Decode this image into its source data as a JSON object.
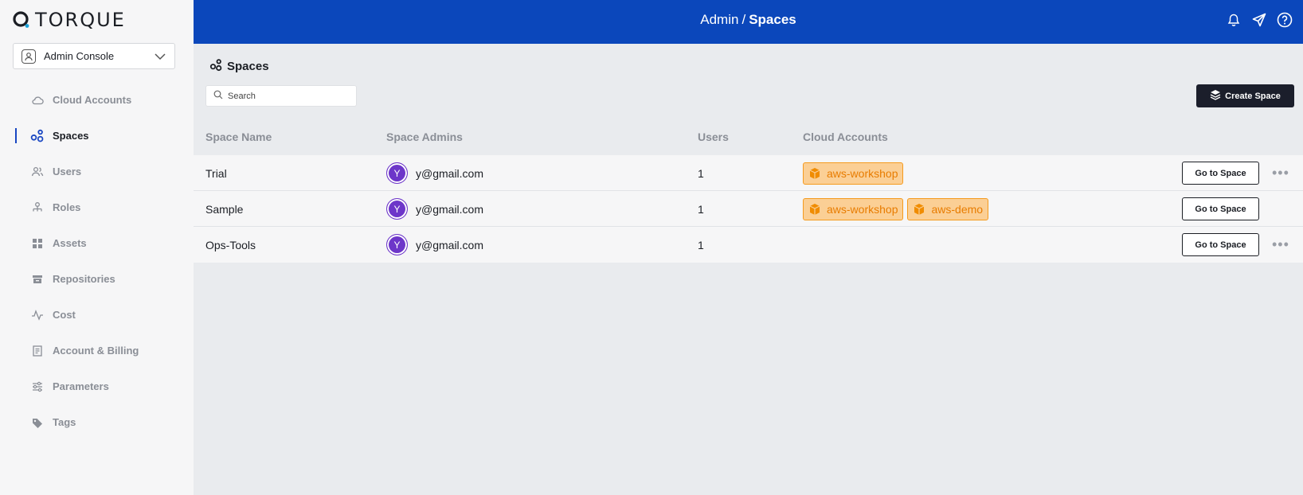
{
  "app": {
    "brand": "TORQUE"
  },
  "console": {
    "label": "Admin Console"
  },
  "nav": [
    {
      "label": "Cloud Accounts",
      "icon": "cloud-icon"
    },
    {
      "label": "Spaces",
      "icon": "spaces-icon",
      "active": true
    },
    {
      "label": "Users",
      "icon": "users-icon"
    },
    {
      "label": "Roles",
      "icon": "roles-icon"
    },
    {
      "label": "Assets",
      "icon": "assets-icon"
    },
    {
      "label": "Repositories",
      "icon": "repositories-icon"
    },
    {
      "label": "Cost",
      "icon": "cost-icon"
    },
    {
      "label": "Account & Billing",
      "icon": "billing-icon"
    },
    {
      "label": "Parameters",
      "icon": "parameters-icon"
    },
    {
      "label": "Tags",
      "icon": "tags-icon"
    }
  ],
  "header": {
    "crumb_root": "Admin",
    "crumb_sep": "/",
    "crumb_current": "Spaces"
  },
  "page": {
    "title": "Spaces",
    "search_placeholder": "Search",
    "create_label": "Create Space"
  },
  "table": {
    "columns": [
      "Space Name",
      "Space Admins",
      "Users",
      "Cloud Accounts"
    ],
    "go_label": "Go to Space",
    "rows": [
      {
        "name": "Trial",
        "admin_initial": "Y",
        "admin": "y@gmail.com",
        "users": "1",
        "clouds": [
          "aws-workshop"
        ],
        "more": true
      },
      {
        "name": "Sample",
        "admin_initial": "Y",
        "admin": "y@gmail.com",
        "users": "1",
        "clouds": [
          "aws-workshop",
          "aws-demo"
        ],
        "more": false
      },
      {
        "name": "Ops-Tools",
        "admin_initial": "Y",
        "admin": "y@gmail.com",
        "users": "1",
        "clouds": [],
        "more": true
      }
    ]
  },
  "colors": {
    "brand_blue": "#0b47bb",
    "accent_orange": "#e87c00",
    "avatar_purple": "#6d36c9"
  }
}
